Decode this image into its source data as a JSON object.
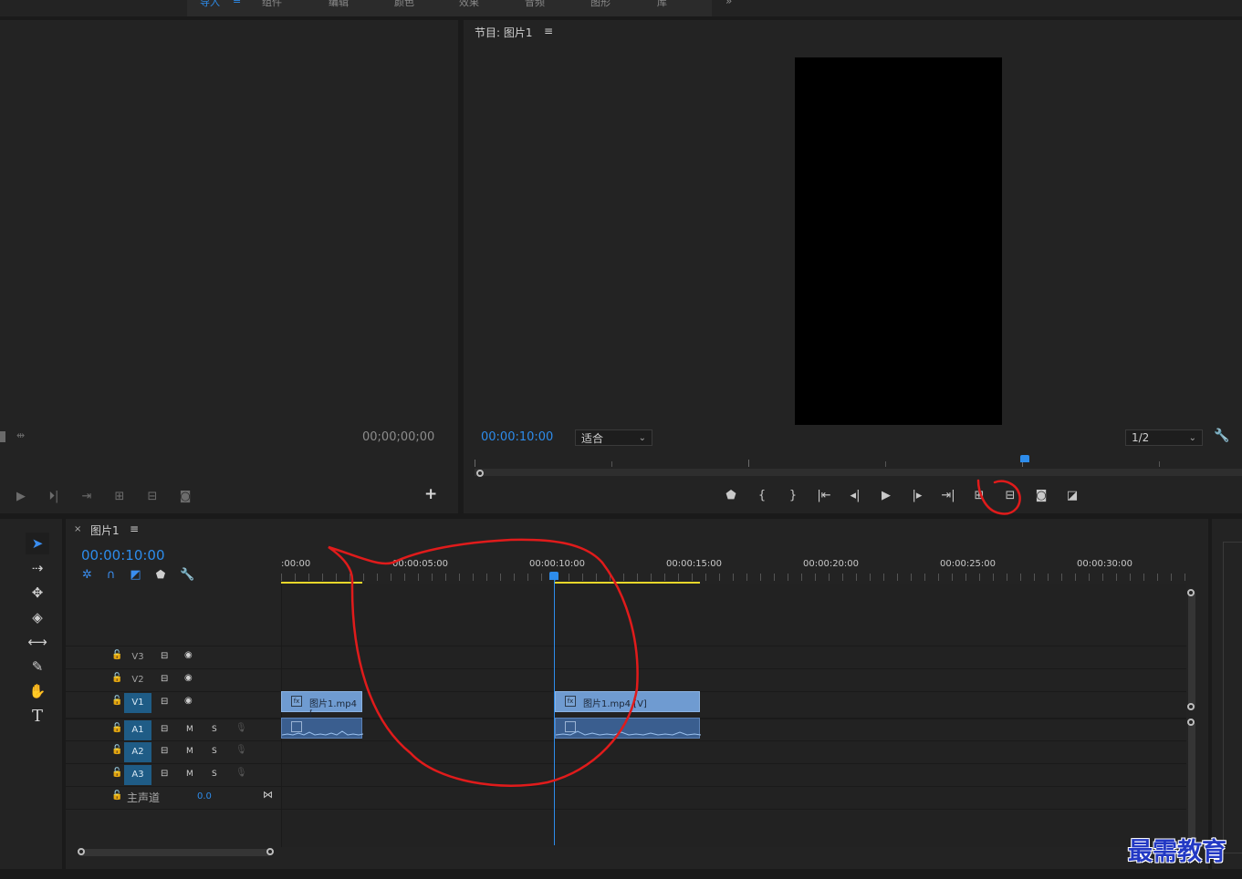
{
  "window": {
    "tabs": [
      "导入",
      "组件",
      "编辑",
      "颜色",
      "效果",
      "音频",
      "图形",
      "库"
    ],
    "more": "»"
  },
  "source_monitor": {
    "timecode": "00;00;00;00",
    "add_button": "+"
  },
  "program_monitor": {
    "title": "节目: 图片1",
    "menu_icon": "≡",
    "timecode": "00:00:10:00",
    "fit_value": "适合",
    "resolution_value": "1/2",
    "controls": [
      "marker-icon",
      "mark-in-icon",
      "mark-out-icon",
      "go-to-in-icon",
      "step-back-icon",
      "play-icon",
      "step-forward-icon",
      "go-to-out-icon",
      "lift-icon",
      "extract-icon",
      "camera-icon",
      "compare-icon"
    ],
    "annotation_color": "#e01b1b"
  },
  "timeline": {
    "tab_close": "×",
    "title": "图片1",
    "menu_icon": "≡",
    "timecode": "00:00:10:00",
    "ruler": ":00:00",
    "ruler_labels": [
      "00:00:05:00",
      "00:00:10:00",
      "00:00:15:00",
      "00:00:20:00",
      "00:00:25:00",
      "00:00:30:00"
    ],
    "video_tracks": [
      {
        "name": "V3",
        "active": false
      },
      {
        "name": "V2",
        "active": false
      },
      {
        "name": "V1",
        "active": true
      }
    ],
    "audio_tracks": [
      {
        "name": "A1",
        "mute": "M",
        "solo": "S"
      },
      {
        "name": "A2",
        "mute": "M",
        "solo": "S"
      },
      {
        "name": "A3",
        "mute": "M",
        "solo": "S"
      }
    ],
    "master": {
      "label": "主声道",
      "value": "0.0"
    },
    "clips": [
      {
        "label": "图片1.mp4 ["
      },
      {
        "label": "图片1.mp4 [V]"
      }
    ],
    "accent": "#2d8ceb"
  },
  "watermark": "最需教育"
}
